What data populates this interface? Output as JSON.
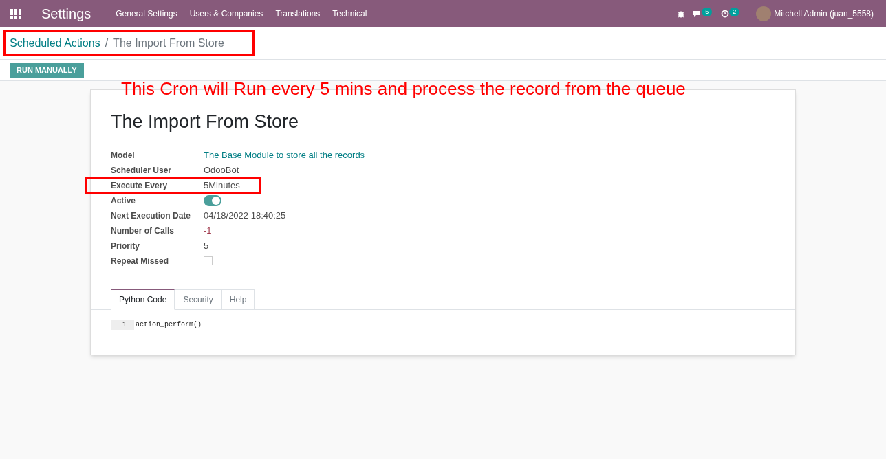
{
  "navbar": {
    "app_title": "Settings",
    "menu": [
      "General Settings",
      "Users & Companies",
      "Translations",
      "Technical"
    ],
    "messages_count": "5",
    "activities_count": "2",
    "user": "Mitchell Admin (juan_5558)"
  },
  "breadcrumb": {
    "parent": "Scheduled Actions",
    "separator": "/",
    "current": "The Import From Store"
  },
  "buttons": [
    "RUN MANUALLY"
  ],
  "annotation": {
    "text": "This Cron will Run every 5 mins and process the record from the queue"
  },
  "form": {
    "title": "The Import From Store",
    "fields": [
      {
        "label": "Model",
        "kind": "link",
        "value": "The Base Module to store all the records"
      },
      {
        "label": "Scheduler User",
        "kind": "text",
        "value": "OdooBot"
      },
      {
        "label": "Execute Every",
        "kind": "text",
        "value": "5Minutes"
      },
      {
        "label": "Active",
        "kind": "toggle",
        "on": true
      },
      {
        "label": "Next Execution Date",
        "kind": "text",
        "value": "04/18/2022 18:40:25"
      },
      {
        "label": "Number of Calls",
        "kind": "negative",
        "value": "-1"
      },
      {
        "label": "Priority",
        "kind": "text",
        "value": "5"
      },
      {
        "label": "Repeat Missed",
        "kind": "checkbox",
        "checked": false
      }
    ],
    "tabs": [
      {
        "label": "Python Code",
        "selected": true
      },
      {
        "label": "Security",
        "selected": false
      },
      {
        "label": "Help",
        "selected": false
      }
    ],
    "code": [
      {
        "line": "1",
        "text": "action_perform()"
      }
    ]
  }
}
